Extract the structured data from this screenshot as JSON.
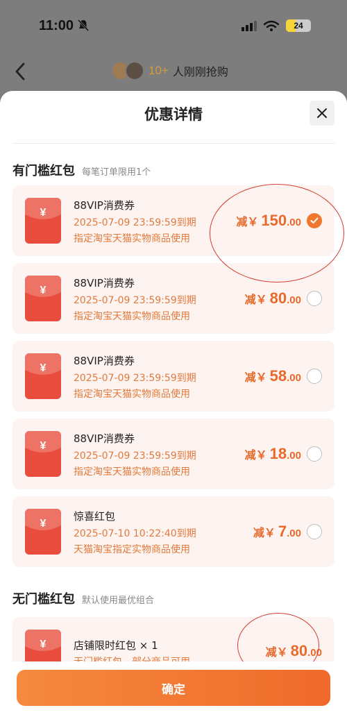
{
  "status": {
    "time": "11:00",
    "battery": "24"
  },
  "header": {
    "buyers_count": "10+",
    "buyers_text": "人刚刚抢购"
  },
  "sheet": {
    "title": "优惠详情"
  },
  "threshold_section": {
    "title": "有门槛红包",
    "subtitle": "每笔订单限用1个",
    "coupons": [
      {
        "name": "88VIP消费券",
        "expiry": "2025-07-09 23:59:59到期",
        "scope": "指定淘宝天猫实物商品使用",
        "prefix": "减￥",
        "amount_int": "150",
        "amount_dec": ".00",
        "selected": true
      },
      {
        "name": "88VIP消费券",
        "expiry": "2025-07-09 23:59:59到期",
        "scope": "指定淘宝天猫实物商品使用",
        "prefix": "减￥",
        "amount_int": "80",
        "amount_dec": ".00",
        "selected": false
      },
      {
        "name": "88VIP消费券",
        "expiry": "2025-07-09 23:59:59到期",
        "scope": "指定淘宝天猫实物商品使用",
        "prefix": "减￥",
        "amount_int": "58",
        "amount_dec": ".00",
        "selected": false
      },
      {
        "name": "88VIP消费券",
        "expiry": "2025-07-09 23:59:59到期",
        "scope": "指定淘宝天猫实物商品使用",
        "prefix": "减￥",
        "amount_int": "18",
        "amount_dec": ".00",
        "selected": false
      },
      {
        "name": "惊喜红包",
        "expiry": "2025-07-10 10:22:40到期",
        "scope": "天猫淘宝指定实物商品使用",
        "prefix": "减￥",
        "amount_int": "7",
        "amount_dec": ".00",
        "selected": false
      }
    ]
  },
  "no_threshold_section": {
    "title": "无门槛红包",
    "subtitle": "默认使用最优组合",
    "coupons": [
      {
        "name": "店铺限时红包 × 1",
        "scope": "无门槛红包，部分商品可用",
        "prefix": "减￥",
        "amount_int": "80",
        "amount_dec": ".00"
      }
    ]
  },
  "footer": {
    "confirm_label": "确定"
  },
  "colors": {
    "accent": "#f0772e",
    "coupon_bg": "#fdf4f1",
    "coupon_icon": "#e74c3c",
    "annotation": "#d63a2e"
  }
}
